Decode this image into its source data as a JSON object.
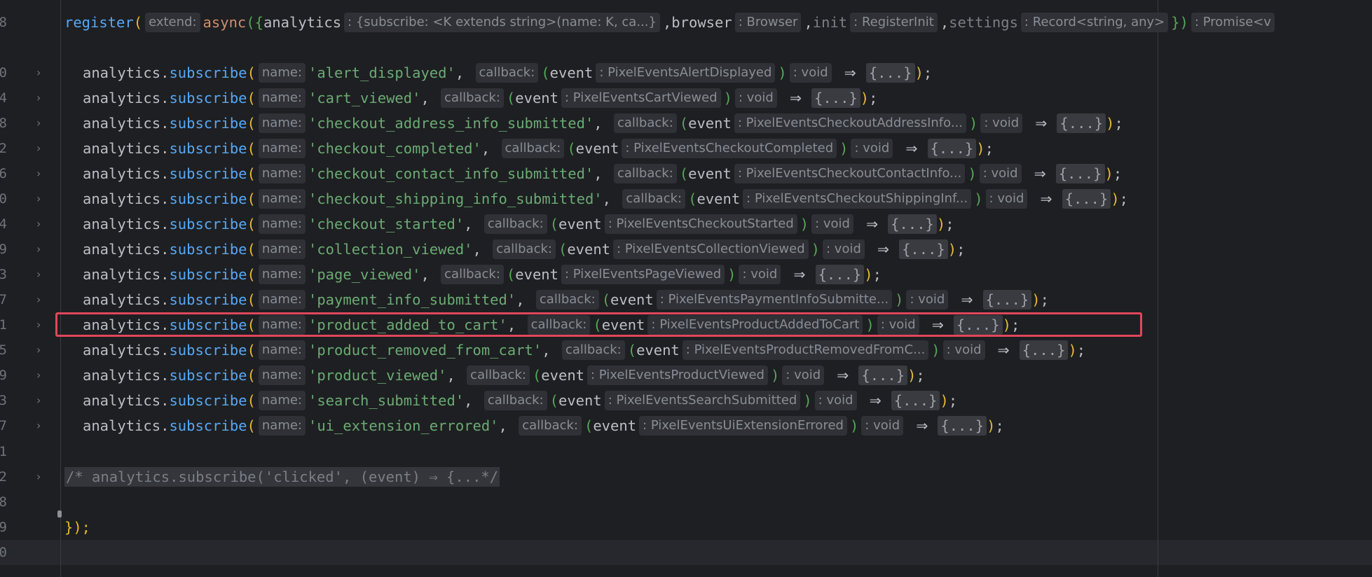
{
  "editor": {
    "header": {
      "line_number": "8",
      "fn": "register",
      "hint_extend": "extend:",
      "kw_async": "async",
      "open": "(",
      "open_brace": "({",
      "param_analytics": "analytics",
      "hint_analytics_type": ": {subscribe: <K extends string>(name: K, ca...}",
      "comma": ",",
      "param_browser": "browser",
      "hint_browser_type": ": Browser",
      "param_init": "init",
      "hint_init_type": ": RegisterInit",
      "param_settings": "settings",
      "hint_settings_type": ": Record<string, any>",
      "close": "})",
      "hint_return": ": Promise<v"
    },
    "name_hint": "name:",
    "callback_hint": "callback:",
    "void_hint": ": void",
    "event_param": "event",
    "arrow": "⇒",
    "fold_placeholder": "{...}",
    "obj": "analytics",
    "dot_method": "subscribe",
    "subscriptions": [
      {
        "line": "0",
        "name": "'alert_displayed'",
        "type": ": PixelEventsAlertDisplayed"
      },
      {
        "line": "4",
        "name": "'cart_viewed'",
        "type": ": PixelEventsCartViewed"
      },
      {
        "line": "8",
        "name": "'checkout_address_info_submitted'",
        "type": ": PixelEventsCheckoutAddressInfo..."
      },
      {
        "line": "2",
        "name": "'checkout_completed'",
        "type": ": PixelEventsCheckoutCompleted"
      },
      {
        "line": "6",
        "name": "'checkout_contact_info_submitted'",
        "type": ": PixelEventsCheckoutContactInfo..."
      },
      {
        "line": "0",
        "name": "'checkout_shipping_info_submitted'",
        "type": ": PixelEventsCheckoutShippingInf..."
      },
      {
        "line": "4",
        "name": "'checkout_started'",
        "type": ": PixelEventsCheckoutStarted"
      },
      {
        "line": "9",
        "name": "'collection_viewed'",
        "type": ": PixelEventsCollectionViewed"
      },
      {
        "line": "3",
        "name": "'page_viewed'",
        "type": ": PixelEventsPageViewed"
      },
      {
        "line": "7",
        "name": "'payment_info_submitted'",
        "type": ": PixelEventsPaymentInfoSubmitte..."
      },
      {
        "line": "1",
        "name": "'product_added_to_cart'",
        "type": ": PixelEventsProductAddedToCart"
      },
      {
        "line": "5",
        "name": "'product_removed_from_cart'",
        "type": ": PixelEventsProductRemovedFromC..."
      },
      {
        "line": "9",
        "name": "'product_viewed'",
        "type": ": PixelEventsProductViewed"
      },
      {
        "line": "3",
        "name": "'search_submitted'",
        "type": ": PixelEventsSearchSubmitted"
      },
      {
        "line": "7",
        "name": "'ui_extension_errored'",
        "type": ": PixelEventsUiExtensionErrored"
      }
    ],
    "blank_line_1": "1",
    "comment_line": "2",
    "comment_text": "/* analytics.subscribe('clicked', (event) ⇒ {...*/",
    "blank_line_2": "8",
    "close_line": "9",
    "close_text": "});",
    "last_line": "0",
    "highlighted_event": "'product_added_to_cart'"
  }
}
